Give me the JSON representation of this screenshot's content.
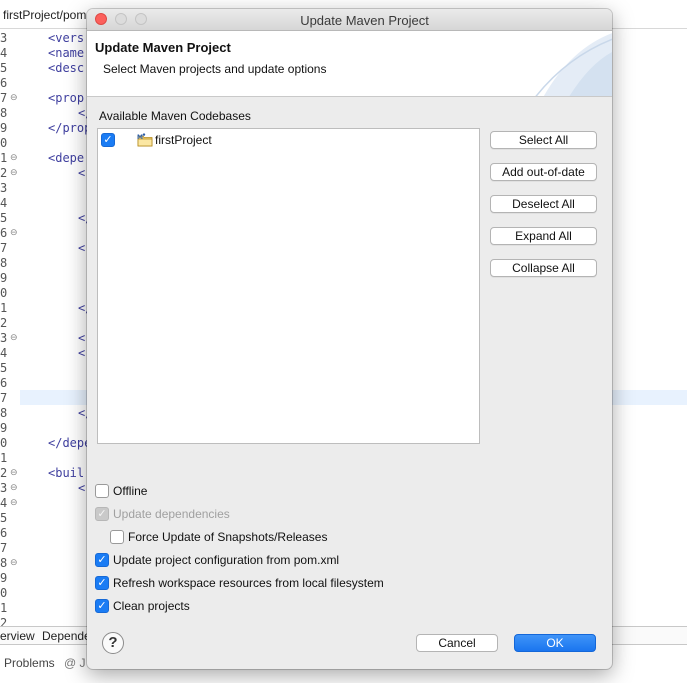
{
  "editor": {
    "tab_title": "firstProject/pom",
    "line_numbers": [
      "3",
      "4",
      "5",
      "6",
      "7",
      "8",
      "9",
      "0",
      "1",
      "2",
      "3",
      "4",
      "5",
      "6",
      "7",
      "8",
      "9",
      "0",
      "1",
      "2",
      "3",
      "4",
      "5",
      "6",
      "7",
      "8",
      "9",
      "0",
      "1",
      "2",
      "3",
      "4",
      "5",
      "6",
      "7",
      "8",
      "9",
      "0",
      "1",
      "2"
    ],
    "code_lines": {
      "l3": "<vers",
      "l4": "<name",
      "l5": "<desc",
      "l7": "<prop",
      "l8": "</",
      "l9": "</prop",
      "l11": "<depe",
      "l12": "<",
      "l15": "</",
      "l17": "<",
      "l21": "</",
      "l23": "<",
      "l24": "<",
      "l28": "</",
      "l30": "</depe",
      "l32": "<buil",
      "l33": "<"
    },
    "bottom_tabs": [
      "erview",
      "Depende"
    ],
    "problems_label": "Problems",
    "at_label": "@ J"
  },
  "dialog": {
    "window_title": "Update Maven Project",
    "header_title": "Update Maven Project",
    "header_description": "Select Maven projects and update options",
    "codebases_label": "Available Maven Codebases",
    "tree": [
      {
        "label": "firstProject",
        "checked": true
      }
    ],
    "side_buttons": {
      "select_all": "Select All",
      "add_out_of_date": "Add out-of-date",
      "deselect_all": "Deselect All",
      "expand_all": "Expand All",
      "collapse_all": "Collapse All"
    },
    "options": {
      "offline": {
        "label": "Offline",
        "checked": false
      },
      "update_dependencies": {
        "label": "Update dependencies",
        "checked": true,
        "disabled": true
      },
      "force_update": {
        "label": "Force Update of Snapshots/Releases",
        "checked": false
      },
      "update_config": {
        "label": "Update project configuration from pom.xml",
        "checked": true
      },
      "refresh_workspace": {
        "label": "Refresh workspace resources from local filesystem",
        "checked": true
      },
      "clean_projects": {
        "label": "Clean projects",
        "checked": true
      }
    },
    "help_glyph": "?",
    "cancel_label": "Cancel",
    "ok_label": "OK"
  },
  "icons": {
    "close": "traffic-light-close",
    "project": "maven-project-folder-icon",
    "check": "✓"
  },
  "colors": {
    "accent": "#1a7cf4",
    "close_button": "#fc605c",
    "dialog_bg": "#ececec"
  }
}
